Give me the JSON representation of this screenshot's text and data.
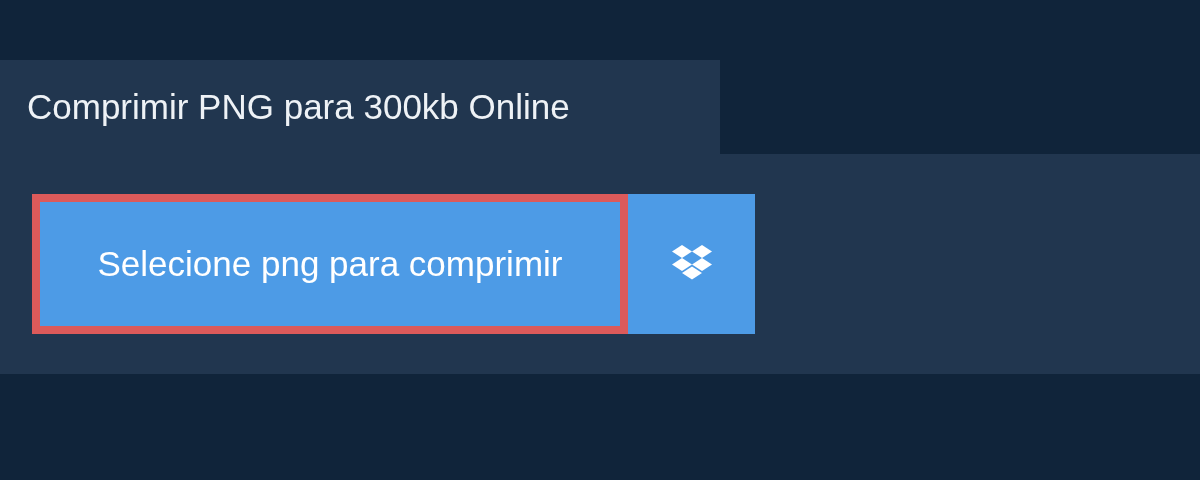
{
  "tab": {
    "title": "Comprimir PNG para 300kb Online"
  },
  "upload": {
    "label": "Selecione png para comprimir",
    "focused": true
  }
}
